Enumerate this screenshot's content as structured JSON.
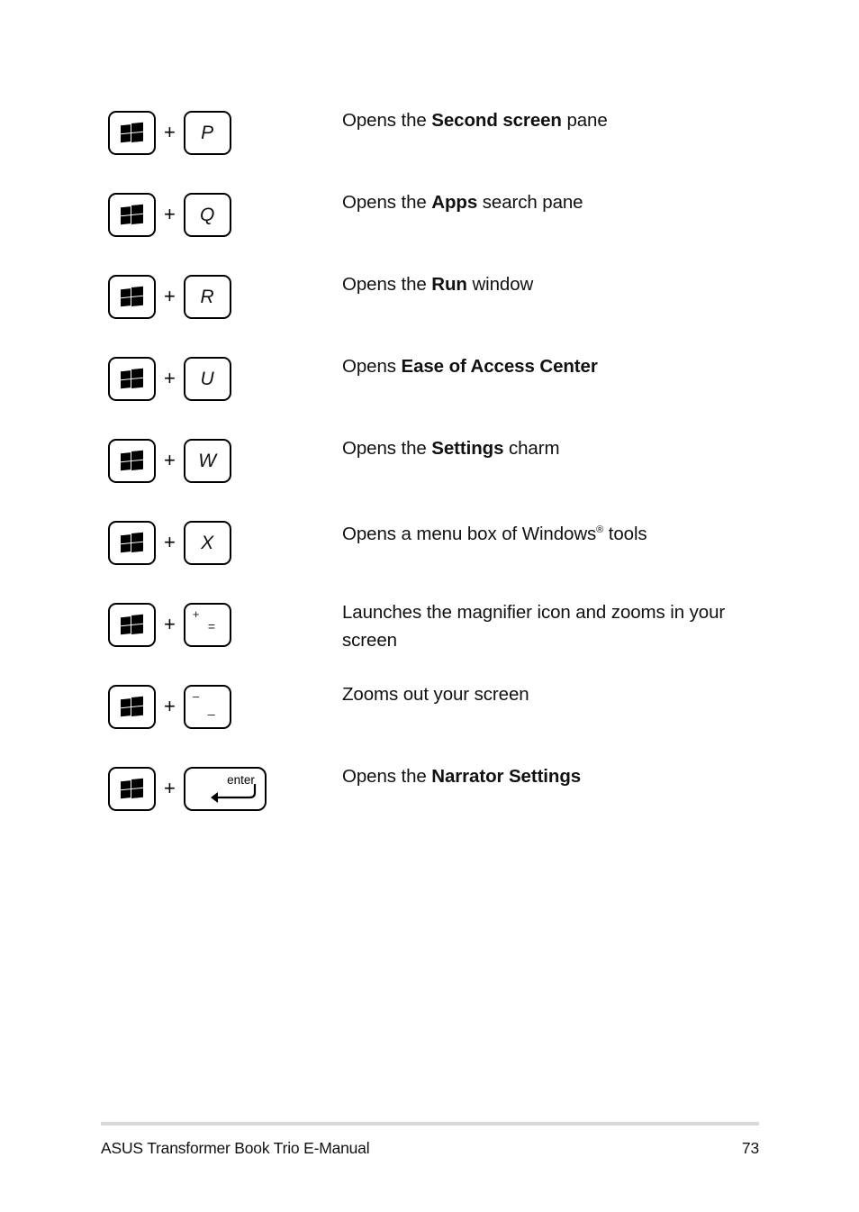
{
  "page": {
    "type": "manual-page",
    "background": "#ffffff",
    "text_color": "#111111",
    "rule_color": "#d9d9d9"
  },
  "shortcuts": [
    {
      "modifier_icon": "windows-logo-icon",
      "key_type": "letter",
      "key_label": "P",
      "separator": "+",
      "description": {
        "before": "Opens the ",
        "bold": "Second screen",
        "after": " pane"
      }
    },
    {
      "modifier_icon": "windows-logo-icon",
      "key_type": "letter",
      "key_label": "Q",
      "separator": "+",
      "description": {
        "before": "Opens the ",
        "bold": "Apps",
        "after": " search pane"
      }
    },
    {
      "modifier_icon": "windows-logo-icon",
      "key_type": "letter",
      "key_label": "R",
      "separator": "+",
      "description": {
        "before": "Opens the ",
        "bold": "Run",
        "after": " window"
      }
    },
    {
      "modifier_icon": "windows-logo-icon",
      "key_type": "letter",
      "key_label": "U",
      "separator": "+",
      "description": {
        "before": "Opens ",
        "bold": "Ease of Access Center",
        "after": ""
      }
    },
    {
      "modifier_icon": "windows-logo-icon",
      "key_type": "letter",
      "key_label": "W",
      "separator": "+",
      "description": {
        "before": "Opens the ",
        "bold": "Settings",
        "after": " charm"
      }
    },
    {
      "modifier_icon": "windows-logo-icon",
      "key_type": "letter",
      "key_label": "X",
      "separator": "+",
      "description": {
        "before": "Opens a menu box of Windows",
        "bold": "",
        "after": " tools",
        "superscript": "®"
      }
    },
    {
      "modifier_icon": "windows-logo-icon",
      "key_type": "dual",
      "key_top_mark": "+",
      "key_bottom_mark": "=",
      "separator": "+",
      "description": {
        "before": "Launches the magnifier icon and zooms in your screen",
        "bold": "",
        "after": ""
      }
    },
    {
      "modifier_icon": "windows-logo-icon",
      "key_type": "dual",
      "key_top_mark": "–",
      "key_bottom_mark": "_",
      "separator": "+",
      "description": {
        "before": "Zooms out your screen",
        "bold": "",
        "after": ""
      }
    },
    {
      "modifier_icon": "windows-logo-icon",
      "key_type": "enter",
      "key_label": "enter",
      "separator": "+",
      "description": {
        "before": "Opens the ",
        "bold": "Narrator Settings",
        "after": ""
      }
    }
  ],
  "footer": {
    "title": "ASUS Transformer Book Trio E-Manual",
    "page_number": "73"
  }
}
